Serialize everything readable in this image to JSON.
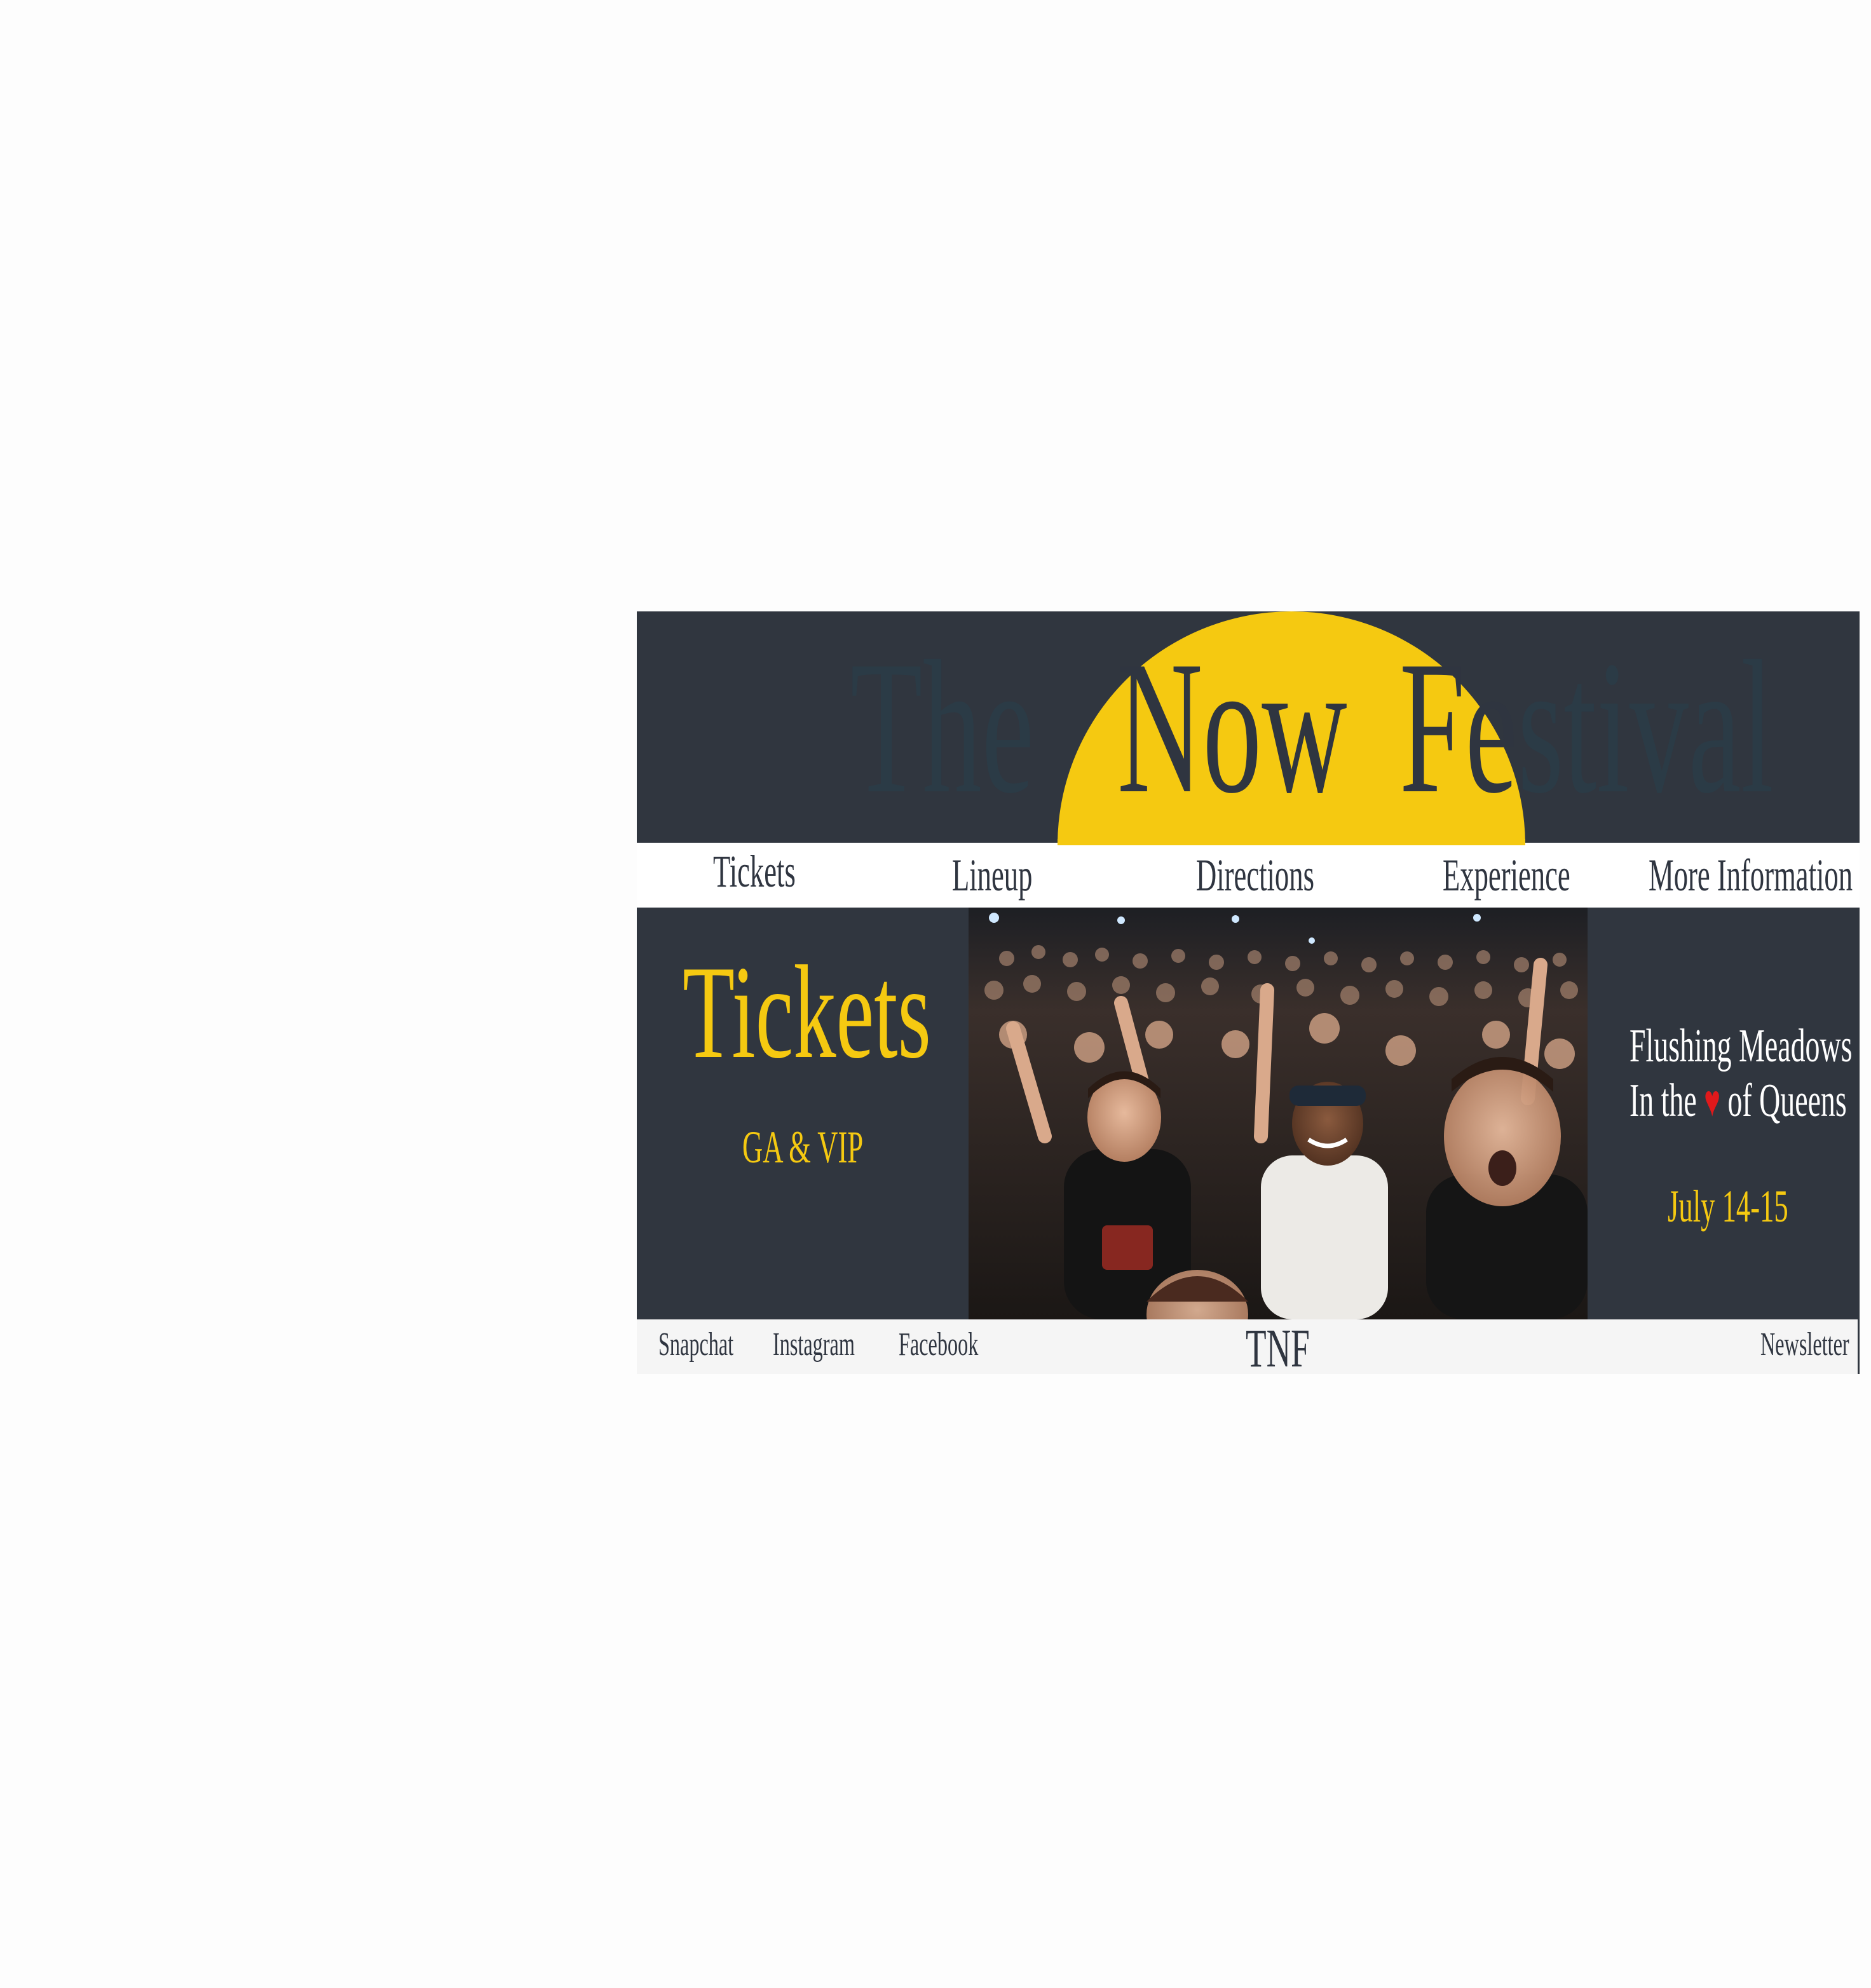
{
  "header": {
    "title_words": [
      "The",
      "Now",
      "Fe",
      "stival"
    ],
    "colors": {
      "background": "#30363f",
      "sun": "#f5c911",
      "title_ghost": "#2b3b46"
    }
  },
  "nav": {
    "items": [
      {
        "label": "Tickets"
      },
      {
        "label": "Lineup"
      },
      {
        "label": "Directions"
      },
      {
        "label": "Experience"
      },
      {
        "label": "More Information"
      }
    ]
  },
  "main": {
    "tickets": {
      "heading": "Tickets",
      "subheading": "GA & VIP"
    },
    "photo": {
      "icon": "crowd-photo"
    },
    "location": {
      "line1": "Flushing Meadows",
      "line2_before": "In the",
      "line2_symbol": "♥",
      "line2_after": "of Queens",
      "dates": "July 14-15"
    }
  },
  "footer": {
    "links": [
      {
        "label": "Snapchat"
      },
      {
        "label": "Instagram"
      },
      {
        "label": "Facebook"
      }
    ],
    "logo": "TNF",
    "newsletter": "Newsletter"
  }
}
